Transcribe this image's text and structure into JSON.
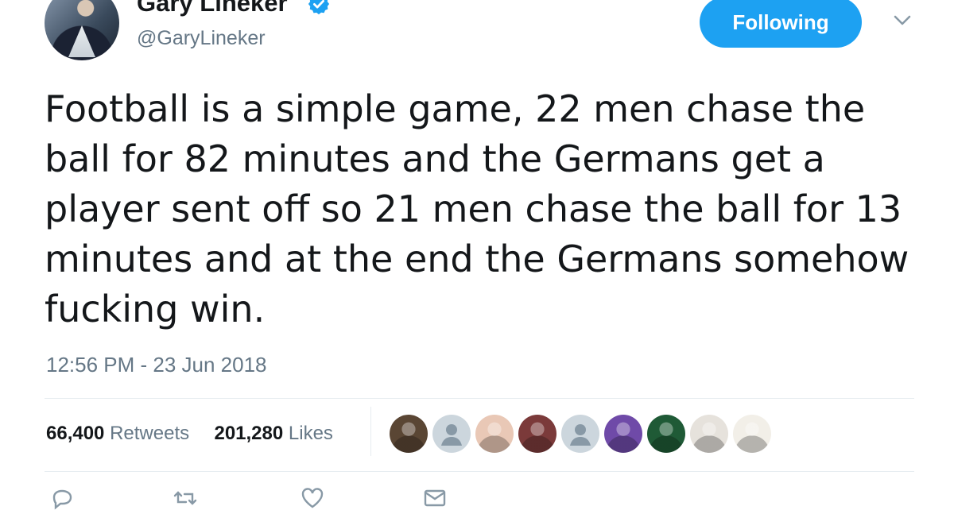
{
  "author": {
    "display_name": "Gary Lineker",
    "handle": "@GaryLineker",
    "verified_icon": "verified-badge-icon",
    "avatar_icon": "profile-photo"
  },
  "header": {
    "follow_label": "Following",
    "menu_icon": "chevron-down-icon"
  },
  "tweet": {
    "text": "Football is a simple game, 22 men chase the ball for 82 minutes and the Germans get a player sent off so 21 men chase the ball for 13 minutes and at the end the Germans somehow fucking win.",
    "timestamp": "12:56 PM - 23 Jun 2018"
  },
  "stats": {
    "retweets_count": "66,400",
    "retweets_label": "Retweets",
    "likes_count": "201,280",
    "likes_label": "Likes"
  },
  "likers": [
    {
      "name": "liker-avatar-1",
      "color": "#5a4634"
    },
    {
      "name": "liker-avatar-2",
      "color": "#ccd6dd"
    },
    {
      "name": "liker-avatar-3",
      "color": "#e9c8b6"
    },
    {
      "name": "liker-avatar-4",
      "color": "#7b3a3a"
    },
    {
      "name": "liker-avatar-5",
      "color": "#ccd6dd"
    },
    {
      "name": "liker-avatar-6",
      "color": "#6f4aa8"
    },
    {
      "name": "liker-avatar-7",
      "color": "#1f5a36"
    },
    {
      "name": "liker-avatar-8",
      "color": "#e6e2dc"
    },
    {
      "name": "liker-avatar-9",
      "color": "#f2efe8"
    }
  ],
  "actions": [
    "reply-icon",
    "retweet-icon",
    "like-icon",
    "message-icon"
  ],
  "colors": {
    "accent": "#1da1f2",
    "text": "#14171a",
    "muted": "#657786",
    "divider": "#e6ecf0"
  }
}
